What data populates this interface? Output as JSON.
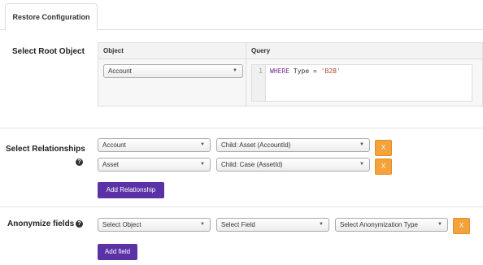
{
  "tabs": [
    {
      "label": "Restore Configuration"
    }
  ],
  "root_object": {
    "label": "Select Root Object",
    "object_header": "Object",
    "query_header": "Query",
    "object_value": "Account",
    "query_line_number": "1",
    "query_keyword": "WHERE",
    "query_field": "Type",
    "query_operator": "=",
    "query_value": "'B2B'"
  },
  "relationships": {
    "label": "Select Relationships",
    "rows": [
      {
        "parent": "Account",
        "child": "Child: Asset (AccountId)",
        "remove": "X"
      },
      {
        "parent": "Asset",
        "child": "Child: Case (AssetId)",
        "remove": "X"
      }
    ],
    "add_button": "Add Relationship"
  },
  "anonymize": {
    "label": "Anonymize fields",
    "object_placeholder": "Select Object",
    "field_placeholder": "Select Field",
    "type_placeholder": "Select Anonymization Type",
    "remove": "X",
    "add_button": "Add field"
  },
  "icons": {
    "help": "question-circle-icon",
    "caret": "caret-down-icon"
  },
  "colors": {
    "primary_button": "#5a32a6",
    "remove_button": "#f5a13c"
  }
}
